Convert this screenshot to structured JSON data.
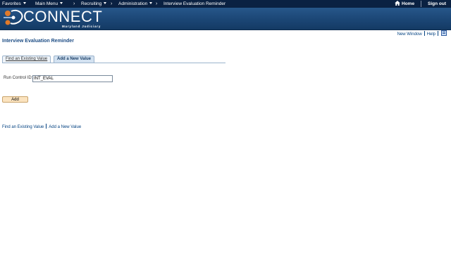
{
  "topnav": {
    "favorites": "Favorites",
    "main_menu": "Main Menu",
    "breadcrumb": [
      "Recruiting",
      "Administration",
      "Interview Evaluation Reminder"
    ],
    "home": "Home",
    "sign_out": "Sign out",
    "background_color": "#0a2142"
  },
  "banner": {
    "logo_text": "CONNECT",
    "logo_subtitle": "Maryland Judiciary",
    "background_color": "#1b4675"
  },
  "utility": {
    "new_window": "New Window",
    "help": "Help",
    "icon": "personalize-page-icon"
  },
  "page": {
    "title": "Interview Evaluation Reminder"
  },
  "tabs": [
    {
      "label": "Find an Existing Value",
      "active": false
    },
    {
      "label": "Add a New Value",
      "active": true
    }
  ],
  "form": {
    "run_control_label": "Run Control ID:",
    "run_control_value": "INT_EVAL",
    "add_button": "Add"
  },
  "bottom_links": {
    "find_existing": "Find an Existing Value",
    "add_new": "Add a New Value"
  }
}
